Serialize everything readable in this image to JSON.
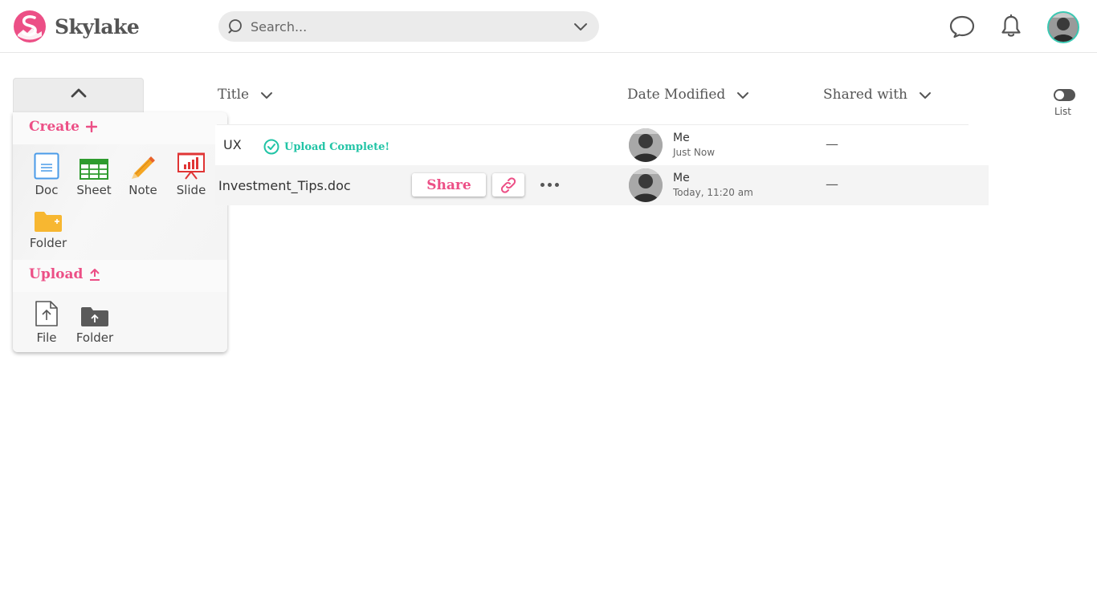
{
  "app": {
    "name": "Skylake",
    "accent": "#ec4f86",
    "success_color": "#22c4a6"
  },
  "search": {
    "placeholder": "Search..."
  },
  "header_icons": [
    "chat-icon",
    "bell-icon",
    "avatar"
  ],
  "new_menu": {
    "create_label": "Create",
    "create_items": [
      {
        "label": "Doc",
        "icon": "doc-icon"
      },
      {
        "label": "Sheet",
        "icon": "sheet-icon"
      },
      {
        "label": "Note",
        "icon": "pencil-icon"
      },
      {
        "label": "Slide",
        "icon": "slide-icon"
      },
      {
        "label": "Folder",
        "icon": "new-folder-icon"
      }
    ],
    "upload_label": "Upload",
    "upload_items": [
      {
        "label": "File",
        "icon": "upload-file-icon"
      },
      {
        "label": "Folder",
        "icon": "upload-folder-icon"
      }
    ]
  },
  "table": {
    "columns": {
      "title": "Title",
      "date_modified": "Date Modified",
      "shared_with": "Shared with"
    },
    "view_toggle_label": "List",
    "rows": [
      {
        "name": "UX",
        "status": "Upload Complete!",
        "owner": "Me",
        "modified": "Just Now",
        "shared_with": "—"
      },
      {
        "name": "Investment_Tips.doc",
        "share_label": "Share",
        "owner": "Me",
        "modified": "Today, 11:20 am",
        "shared_with": "—"
      }
    ]
  }
}
